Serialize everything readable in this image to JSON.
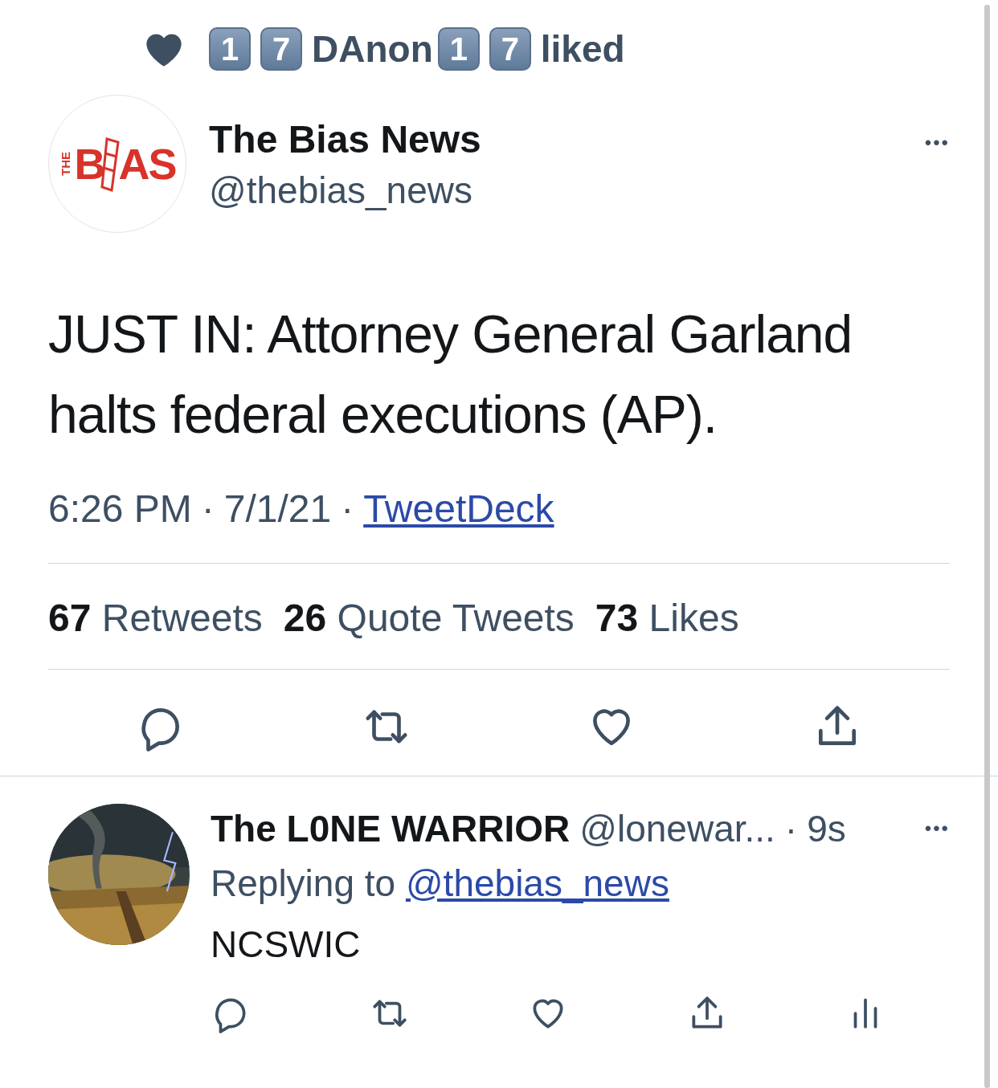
{
  "social_context": {
    "parts": [
      {
        "kind": "keycap",
        "text": "1"
      },
      {
        "kind": "keycap",
        "text": "7"
      },
      {
        "kind": "text",
        "text": "DAnon"
      },
      {
        "kind": "keycap",
        "text": "1"
      },
      {
        "kind": "keycap",
        "text": "7"
      }
    ],
    "action": "liked"
  },
  "tweet": {
    "logo": {
      "side": "THE",
      "left": "B",
      "right": "AS"
    },
    "name": "The Bias News",
    "handle": "@thebias_news",
    "more": "•••",
    "text": "JUST IN: Attorney General Garland halts federal executions (AP).",
    "time": "6:26 PM",
    "date": "7/1/21",
    "separator": "·",
    "source": "TweetDeck",
    "stats": [
      {
        "count": "67",
        "label": "Retweets"
      },
      {
        "count": "26",
        "label": "Quote Tweets"
      },
      {
        "count": "73",
        "label": "Likes"
      }
    ],
    "actions": [
      {
        "kind": "reply"
      },
      {
        "kind": "retweet"
      },
      {
        "kind": "like"
      },
      {
        "kind": "share"
      }
    ]
  },
  "reply": {
    "name": "The L0NE WARRIOR",
    "handle": "@lonewar...",
    "separator": "·",
    "age": "9s",
    "more": "•••",
    "replying_label": "Replying to",
    "replying_to": "@thebias_news",
    "text": "NCSWIC",
    "actions": [
      {
        "kind": "reply"
      },
      {
        "kind": "retweet"
      },
      {
        "kind": "like"
      },
      {
        "kind": "share"
      },
      {
        "kind": "analytics"
      }
    ]
  }
}
